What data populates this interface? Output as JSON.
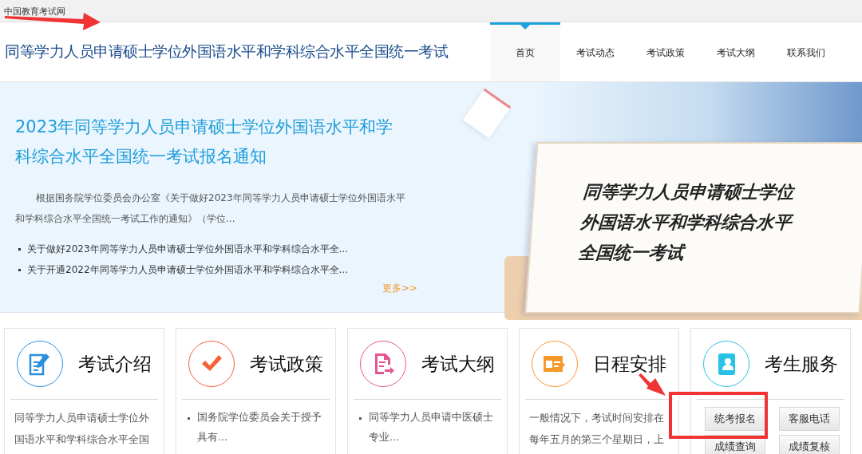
{
  "site_name": "中国教育考试网",
  "header": {
    "title": "同等学力人员申请硕士学位外国语水平和学科综合水平全国统一考试"
  },
  "nav": [
    {
      "label": "首页",
      "selected": true
    },
    {
      "label": "考试动态",
      "selected": false
    },
    {
      "label": "考试政策",
      "selected": false
    },
    {
      "label": "考试大纲",
      "selected": false
    },
    {
      "label": "联系我们",
      "selected": false
    }
  ],
  "banner": {
    "title": "2023年同等学力人员申请硕士学位外国语水平和学科综合水平全国统一考试报名通知",
    "summary": "根据国务院学位委员会办公室《关于做好2023年同等学力人员申请硕士学位外国语水平和学科综合水平全国统一考试工作的通知》（学位...",
    "links": [
      "关于做好2023年同等学力人员申请硕士学位外国语水平和学科综合水平全...",
      "关于开通2022年同等学力人员申请硕士学位外国语水平和学科综合水平全..."
    ],
    "more": "更多>>",
    "card_lines": [
      "同等学力人员申请硕士学位",
      "外国语水平和学科综合水平",
      "全国统一考试"
    ]
  },
  "cards": [
    {
      "title": "考试介绍",
      "color": "#2b8fe0",
      "kind": "text",
      "text": "同等学力人员申请硕士学位外国语水平和学科综合水平全国"
    },
    {
      "title": "考试政策",
      "color": "#f4623a",
      "kind": "list",
      "items": [
        "国务院学位委员会关于授予具有..."
      ]
    },
    {
      "title": "考试大纲",
      "color": "#e2578f",
      "kind": "list",
      "items": [
        "同等学力人员申请中医硕士专业..."
      ]
    },
    {
      "title": "日程安排",
      "color": "#f39a2b",
      "kind": "text",
      "text": "一般情况下，考试时间安排在每年五月的第三个星期日，上"
    },
    {
      "title": "考生服务",
      "color": "#27c3e6",
      "kind": "buttons",
      "buttons": [
        "统考报名",
        "客服电话",
        "成绩查询",
        "成绩复核"
      ]
    }
  ]
}
